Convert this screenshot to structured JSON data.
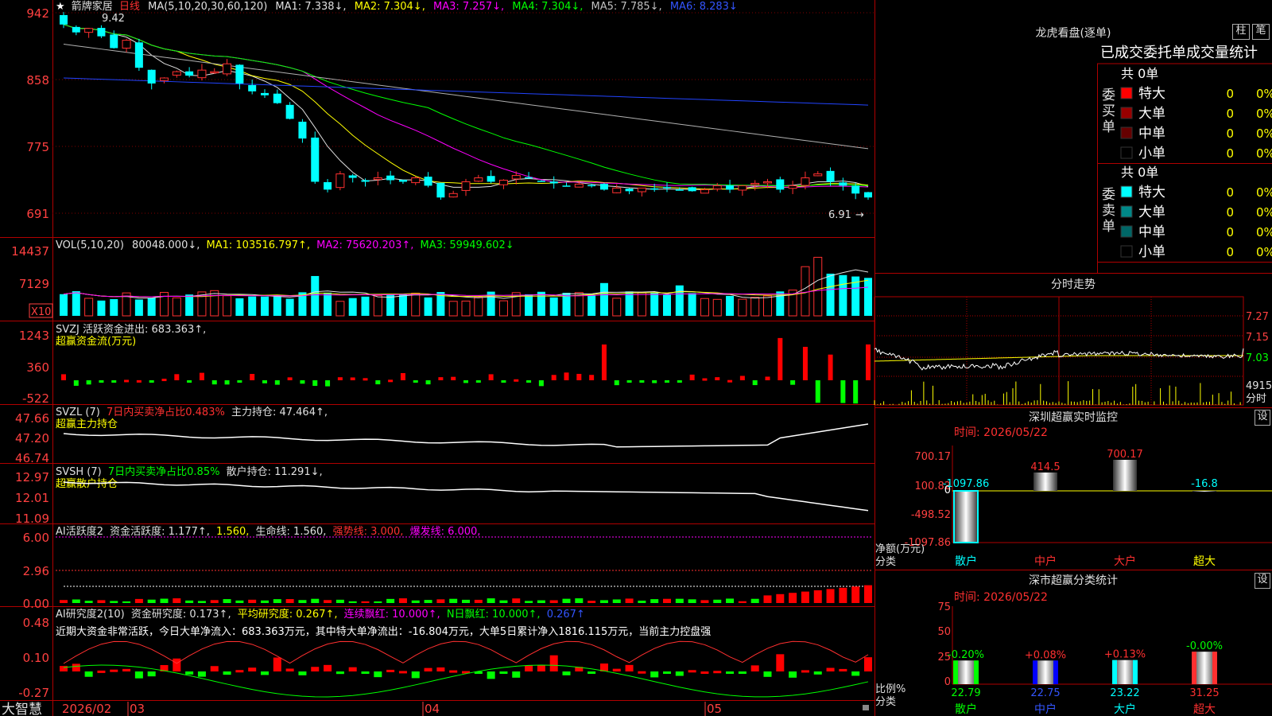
{
  "header": {
    "star": "★",
    "stock_name": "箭牌家居",
    "period": "日线",
    "ma_label": "MA(5,10,20,30,60,120)",
    "ma_items": [
      {
        "text": "MA1: 7.338↓,",
        "color": "#e0e0e0"
      },
      {
        "text": "MA2: 7.304↓,",
        "color": "#ffff00"
      },
      {
        "text": "MA3: 7.257↓,",
        "color": "#ff00ff"
      },
      {
        "text": "MA4: 7.304↓,",
        "color": "#00ff00"
      },
      {
        "text": "MA5: 7.785↓,",
        "color": "#c0c0c0"
      },
      {
        "text": "MA6: 8.283↓",
        "color": "#3355ff"
      }
    ],
    "high_label": "9.42",
    "low_label": "6.91"
  },
  "price_panel": {
    "y_ticks": [
      "942",
      "858",
      "775",
      "691"
    ]
  },
  "vol_panel": {
    "title": "VOL(5,10,20)",
    "value": "80048.000↓,",
    "ma1": "MA1: 103516.797↑,",
    "ma2": "MA2: 75620.203↑,",
    "ma3": "MA3: 59949.602↓",
    "y_ticks": [
      "14437",
      "7129"
    ],
    "unit": "X10"
  },
  "svzj_panel": {
    "line1": "SVZJ  活跃资金进出: 683.363↑,",
    "line2": "超赢资金流(万元)",
    "y_ticks": [
      "1243",
      "360",
      "-522"
    ]
  },
  "svzl_panel": {
    "name": "SVZL (7)",
    "ratio": "7日内买卖净占比0.483%",
    "hold": "主力持仓: 47.464↑,",
    "line2": "超赢主力持仓",
    "y_ticks": [
      "47.66",
      "47.20",
      "46.74"
    ]
  },
  "svsh_panel": {
    "name": "SVSH (7)",
    "ratio": "7日内买卖净占比0.85%",
    "hold": "散户持仓: 11.291↓,",
    "line2": "超赢散户持仓",
    "y_ticks": [
      "12.97",
      "12.01",
      "11.09"
    ]
  },
  "ai_active_panel": {
    "name": "AI活跃度2",
    "a": "资金活跃度: 1.177↑,",
    "b": "1.560,",
    "c": "生命线: 1.560,",
    "d": "强势线: 3.000,",
    "e": "爆发线: 6.000,",
    "y_ticks": [
      "6.00",
      "2.96",
      "0.00"
    ]
  },
  "ai_research_panel": {
    "name": "AI研究度2(10)",
    "a": "资金研究度: 0.173↑,",
    "b": "平均研究度: 0.267↑,",
    "c": "连续飘红: 10.000↑,",
    "d": "N日飘红: 10.000↑,",
    "e": "0.267↑",
    "summary": "近期大资金非常活跃，今日大单净流入：683.363万元，其中特大单净流出：-16.804万元，大单5日累计净入1816.115万元，当前主力控盘强",
    "y_ticks": [
      "0.48",
      "0.10",
      "-0.27"
    ]
  },
  "x_axis": {
    "brand": "大智慧",
    "labels": [
      "2026/02",
      "03",
      "04",
      "05"
    ]
  },
  "dragon_tiger": {
    "title": "龙虎看盘(逐单)",
    "btn_zhu": "柱",
    "btn_bi": "笔",
    "subtitle": "已成交委托单成交量统计",
    "buy_side_label": "委买单",
    "sell_side_label": "委卖单",
    "buy_total": "共 0单",
    "sell_total": "共 0单",
    "buy_rows": [
      {
        "label": "特大",
        "count": "0",
        "pct": "0%",
        "color": "#ff0000"
      },
      {
        "label": "大单",
        "count": "0",
        "pct": "0%",
        "color": "#990000"
      },
      {
        "label": "中单",
        "count": "0",
        "pct": "0%",
        "color": "#660000"
      },
      {
        "label": "小单",
        "count": "0",
        "pct": "0%",
        "color": "#000000"
      }
    ],
    "sell_rows": [
      {
        "label": "特大",
        "count": "0",
        "pct": "0%",
        "color": "#00ffff"
      },
      {
        "label": "大单",
        "count": "0",
        "pct": "0%",
        "color": "#008888"
      },
      {
        "label": "中单",
        "count": "0",
        "pct": "0%",
        "color": "#006666"
      },
      {
        "label": "小单",
        "count": "0",
        "pct": "0%",
        "color": "#000000"
      }
    ]
  },
  "intraday": {
    "title": "分时走势",
    "y_ticks": [
      "7.27",
      "7.15",
      "7.03"
    ],
    "vol_tick": "4915",
    "vol_unit": "分时"
  },
  "monitor": {
    "title": "深圳超赢实时监控",
    "btn": "设",
    "time": "时间: 2026/05/22",
    "y_ticks": [
      "700.17",
      "100.82",
      "-498.52",
      "-1097.86"
    ],
    "zero_tick": "0",
    "axis_label_1": "净额(万元)",
    "axis_label_2": "分类",
    "categories": [
      "散户",
      "中户",
      "大户",
      "超大"
    ],
    "values": [
      -1097.86,
      414.5,
      700.17,
      -16.8
    ],
    "value_labels": [
      "-1097.86",
      "414.5",
      "700.17",
      "-16.8"
    ]
  },
  "stats": {
    "title": "深市超赢分类统计",
    "btn": "设",
    "time": "时间: 2026/05/22",
    "y_ticks": [
      "75",
      "50",
      "25",
      "0"
    ],
    "axis_label_1": "比例%",
    "axis_label_2": "分类",
    "categories": [
      "散户",
      "中户",
      "大户",
      "超大"
    ],
    "values": [
      22.79,
      22.75,
      23.22,
      31.25
    ],
    "value_labels": [
      "22.79",
      "22.75",
      "23.22",
      "31.25"
    ],
    "changes": [
      "-0.20%",
      "+0.08%",
      "+0.13%",
      "-0.00%"
    ]
  },
  "chart_data": [
    {
      "type": "candlestick",
      "title": "箭牌家居 日线",
      "x_range": [
        "2026/02",
        "2026/05/22"
      ],
      "ylim": [
        6.91,
        9.42
      ],
      "high": 9.42,
      "low": 6.91,
      "close_series": [
        9.3,
        9.2,
        9.25,
        9.15,
        9.0,
        9.1,
        8.75,
        8.55,
        8.62,
        8.7,
        8.65,
        8.72,
        8.7,
        8.8,
        8.55,
        8.45,
        8.4,
        8.3,
        8.1,
        7.85,
        7.3,
        7.2,
        7.4,
        7.35,
        7.3,
        7.35,
        7.32,
        7.3,
        7.35,
        7.25,
        7.1,
        7.15,
        7.3,
        7.35,
        7.3,
        7.32,
        7.38,
        7.35,
        7.3,
        7.28,
        7.25,
        7.27,
        7.25,
        7.2,
        7.22,
        7.18,
        7.22,
        7.2,
        7.22,
        7.2,
        7.18,
        7.2,
        7.25,
        7.2,
        7.25,
        7.28,
        7.3,
        7.2,
        7.25,
        7.35,
        7.4,
        7.3,
        7.25,
        7.15,
        7.1
      ]
    },
    {
      "type": "bar",
      "title": "VOL(5,10,20)",
      "last_value": 80048.0,
      "ylim": [
        0,
        14437
      ]
    },
    {
      "type": "bar",
      "title": "深圳超赢实时监控",
      "categories": [
        "散户",
        "中户",
        "大户",
        "超大"
      ],
      "values": [
        -1097.86,
        414.5,
        700.17,
        -16.8
      ],
      "ylim": [
        -1097.86,
        700.17
      ],
      "ylabel": "净额(万元)"
    },
    {
      "type": "bar",
      "title": "深市超赢分类统计",
      "categories": [
        "散户",
        "中户",
        "大户",
        "超大"
      ],
      "values": [
        22.79,
        22.75,
        23.22,
        31.25
      ],
      "ylim": [
        0,
        75
      ],
      "ylabel": "比例%"
    }
  ]
}
